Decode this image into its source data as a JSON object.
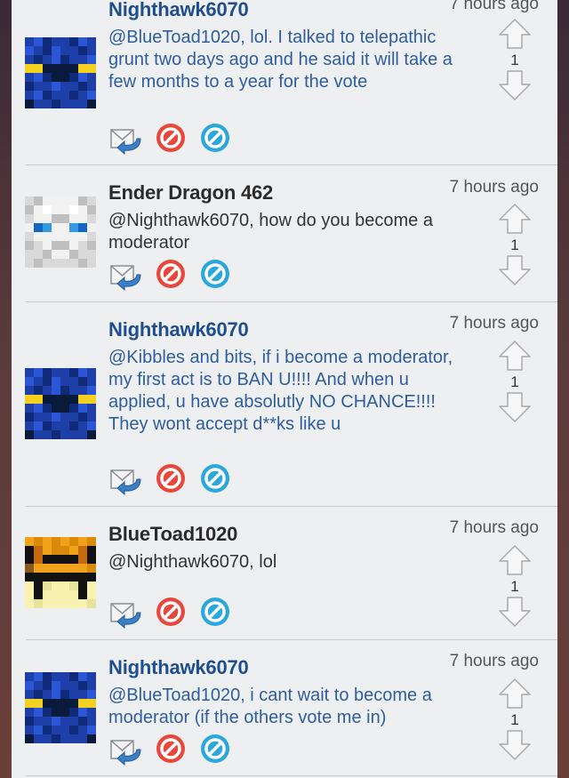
{
  "comments": [
    {
      "author": "Nighthawk6070",
      "time": "7 hours ago",
      "text": "@BlueToad1020, lol. I talked to telepathic grunt two days ago and he said it will take a few months to a year for the vote",
      "votes": "1",
      "avatar": "nighthawk"
    },
    {
      "author": "Ender Dragon 462",
      "time": "7 hours ago",
      "text": "@Nighthawk6070, how do you become a moderator",
      "votes": "1",
      "avatar": "ender"
    },
    {
      "author": "Nighthawk6070",
      "time": "7 hours ago",
      "text": "@Kibbles and bits, if i become a moderator, my first act is to BAN U!!!! And when u applied, u have absolutly NO CHANCE!!!! They wont accept d**ks like u",
      "votes": "1",
      "avatar": "nighthawk"
    },
    {
      "author": "BlueToad1020",
      "time": "7 hours ago",
      "text": "@Nighthawk6070, lol",
      "votes": "1",
      "avatar": "bluetoad"
    },
    {
      "author": "Nighthawk6070",
      "time": "7 hours ago",
      "text": "@BlueToad1020, i cant wait to become a moderator (if the others vote me in)",
      "votes": "1",
      "avatar": "nighthawk"
    }
  ],
  "icons": {
    "reply": "reply-icon",
    "report": "report-icon",
    "block": "block-icon",
    "upvote": "upvote-arrow-icon",
    "downvote": "downvote-arrow-icon"
  },
  "colors": {
    "author_blue": "#1f4e8c",
    "text_blue": "#2e5e9c",
    "report_red": "#e8473c",
    "block_blue": "#2aa7dd"
  }
}
